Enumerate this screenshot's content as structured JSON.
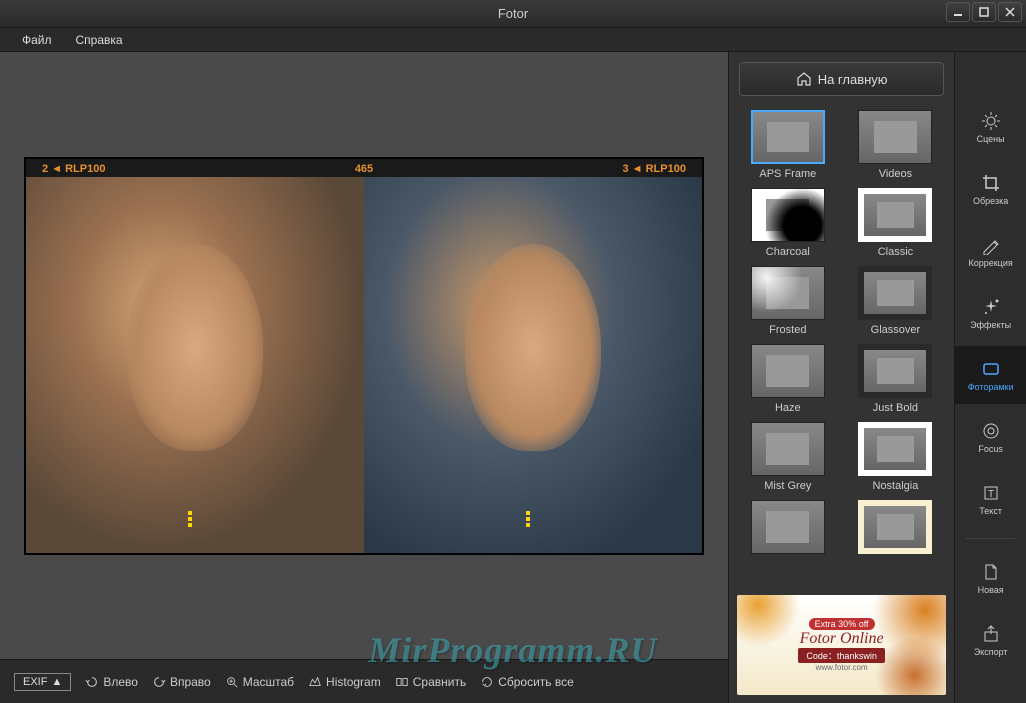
{
  "app_title": "Fotor",
  "menubar": {
    "file": "Файл",
    "help": "Справка"
  },
  "home_button": "На главную",
  "film_markers": {
    "left": "2 ◄ RLP100",
    "center": "465",
    "right": "3 ◄ RLP100"
  },
  "bottom_toolbar": {
    "exif": "EXIF",
    "rotate_left": "Влево",
    "rotate_right": "Вправо",
    "zoom": "Масштаб",
    "histogram": "Histogram",
    "compare": "Сравнить",
    "reset": "Сбросить все"
  },
  "frames": [
    {
      "label": "APS Frame",
      "selected": true,
      "style": "selected"
    },
    {
      "label": "Videos",
      "style": "videos"
    },
    {
      "label": "Charcoal",
      "style": "charcoal"
    },
    {
      "label": "Classic",
      "style": "white-border"
    },
    {
      "label": "Frosted",
      "style": "frosted"
    },
    {
      "label": "Glassover",
      "style": "dark-border"
    },
    {
      "label": "Haze",
      "style": "plain"
    },
    {
      "label": "Just Bold",
      "style": "dark-border"
    },
    {
      "label": "Mist Grey",
      "style": "plain"
    },
    {
      "label": "Nostalgia",
      "style": "white-border"
    },
    {
      "label": "",
      "style": "plain"
    },
    {
      "label": "",
      "style": "cream-border"
    }
  ],
  "tools": [
    {
      "label": "Сцены",
      "icon": "sun"
    },
    {
      "label": "Обрезка",
      "icon": "crop"
    },
    {
      "label": "Коррекция",
      "icon": "pencil"
    },
    {
      "label": "Эффекты",
      "icon": "sparkle"
    },
    {
      "label": "Фоторамки",
      "icon": "frame",
      "active": true
    },
    {
      "label": "Focus",
      "icon": "target"
    },
    {
      "label": "Текст",
      "icon": "text"
    }
  ],
  "tools2": [
    {
      "label": "Новая",
      "icon": "file"
    },
    {
      "label": "Экспорт",
      "icon": "export"
    }
  ],
  "promo": {
    "discount": "Extra 30% off",
    "title": "Fotor Online",
    "code": "Code：thankswin",
    "url": "www.fotor.com"
  },
  "watermark": "MirProgramm.RU"
}
